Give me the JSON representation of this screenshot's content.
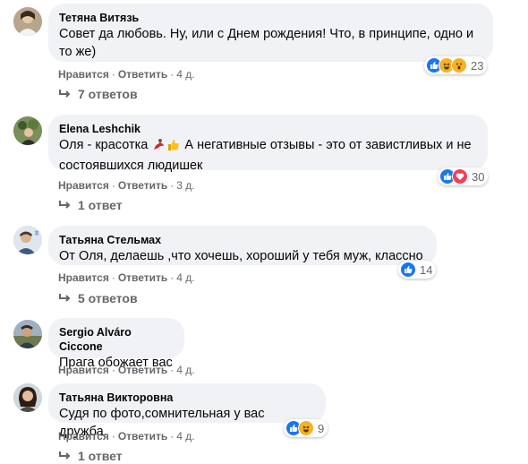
{
  "labels": {
    "like": "Нравится",
    "reply": "Ответить",
    "separator": "·"
  },
  "comments": [
    {
      "author": "Тетяна Витязь",
      "text": "Совет да любовь. Ну, или с Днем рождения! Что, в принципе, одно и то же)",
      "time": "4 д.",
      "reaction_count": "23",
      "reactions": [
        "like-icon",
        "haha-icon",
        "wow-icon"
      ],
      "replies": "7 ответов"
    },
    {
      "author": "Elena Leshchik",
      "text_before": "Оля - красотка",
      "text_after": " А негативные отзывы - это от завистливых и не состоявшихся людишек",
      "emojis": [
        "dancer-emoji",
        "thumbs-up-emoji"
      ],
      "time": "3 д.",
      "reaction_count": "30",
      "reactions": [
        "like-icon",
        "love-icon"
      ],
      "replies": "1 ответ"
    },
    {
      "author": "Татьяна Стельмах",
      "text": "От Оля, делаешь ,что хочешь, хороший у тебя муж, классно",
      "time": "4 д.",
      "reaction_count": "14",
      "reactions": [
        "like-icon"
      ],
      "replies": "5 ответов"
    },
    {
      "author": "Sergio Alváro Ciccone",
      "text": "Прага обожает вас",
      "time": "4 д."
    },
    {
      "author": "Татьяна Викторовна",
      "text": "Судя по фото,сомнительная у вас дружба.",
      "time": "4 д.",
      "reaction_count": "9",
      "reactions": [
        "like-icon",
        "haha-icon"
      ],
      "replies": "1 ответ"
    }
  ],
  "colors": {
    "bubble": "#f0f2f5",
    "meta_text": "#65676b",
    "like_blue": "#1877f2",
    "love_red": "#f33e58",
    "haha_yellow": "#f7b125"
  }
}
